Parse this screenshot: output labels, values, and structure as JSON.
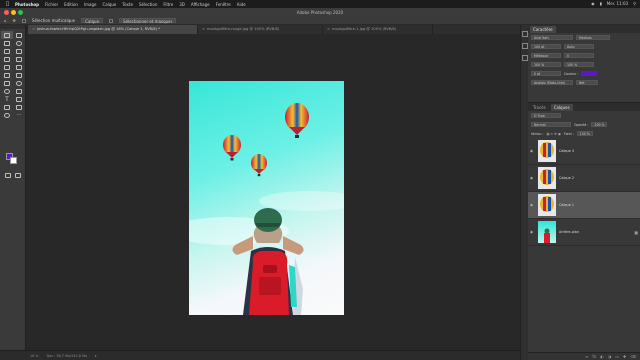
{
  "menubar": {
    "app": "Photoshop",
    "items": [
      "Fichier",
      "Edition",
      "Image",
      "Calque",
      "Texte",
      "Sélection",
      "Filtre",
      "3D",
      "Affichage",
      "Fenêtre",
      "Aide"
    ],
    "clock": "Mer. 11:03"
  },
  "window": {
    "title": "Adobe Photoshop 2020"
  },
  "options": {
    "sample_all": "Sélection multicalque",
    "mode": "Calque",
    "refine": "Sélectionner et masquer"
  },
  "tabs": [
    {
      "label": "joshua-fowler-HEnhpQ2tPgI-unsplash.jpg @ 16% (Calque 1, RVB/8) *",
      "active": true
    },
    {
      "label": "montgolfière-rouge.jpg @ 100% (RVB/8)",
      "active": false
    },
    {
      "label": "montgolfière-1.jpg @ 100% (RVB/8)",
      "active": false
    }
  ],
  "status": {
    "zoom": "16 %",
    "doc": "Doc : 56,7 Mo/242,8 Mo"
  },
  "panels": {
    "top_tabs": [
      "Caractère"
    ],
    "character": {
      "font": "Arial Italy",
      "style": "Medium",
      "size": "100 pt",
      "leading": "Auto",
      "tracking": "Métrique",
      "kerning": "0",
      "scale_v": "100 %",
      "scale_h": "100 %",
      "baseline": "0 pt",
      "color_label": "Couleur :",
      "lang": "Anglais (Etats-Unis)",
      "aa": "Net"
    },
    "layer_tabs": [
      "Tracés",
      "Calques"
    ],
    "layers": {
      "filter": "Q Type",
      "blend": "Normal",
      "opacity_label": "Opacité :",
      "opacity": "100 %",
      "lock_label": "Verrou :",
      "fill_label": "Fond :",
      "fill": "100 %",
      "items": [
        {
          "name": "Calque 3",
          "selected": false
        },
        {
          "name": "Calque 2",
          "selected": false
        },
        {
          "name": "Calque 1",
          "selected": true
        },
        {
          "name": "Arrière-plan",
          "selected": false
        }
      ]
    }
  },
  "colors": {
    "foreground": "#5b18c8",
    "background": "#ffffff"
  }
}
